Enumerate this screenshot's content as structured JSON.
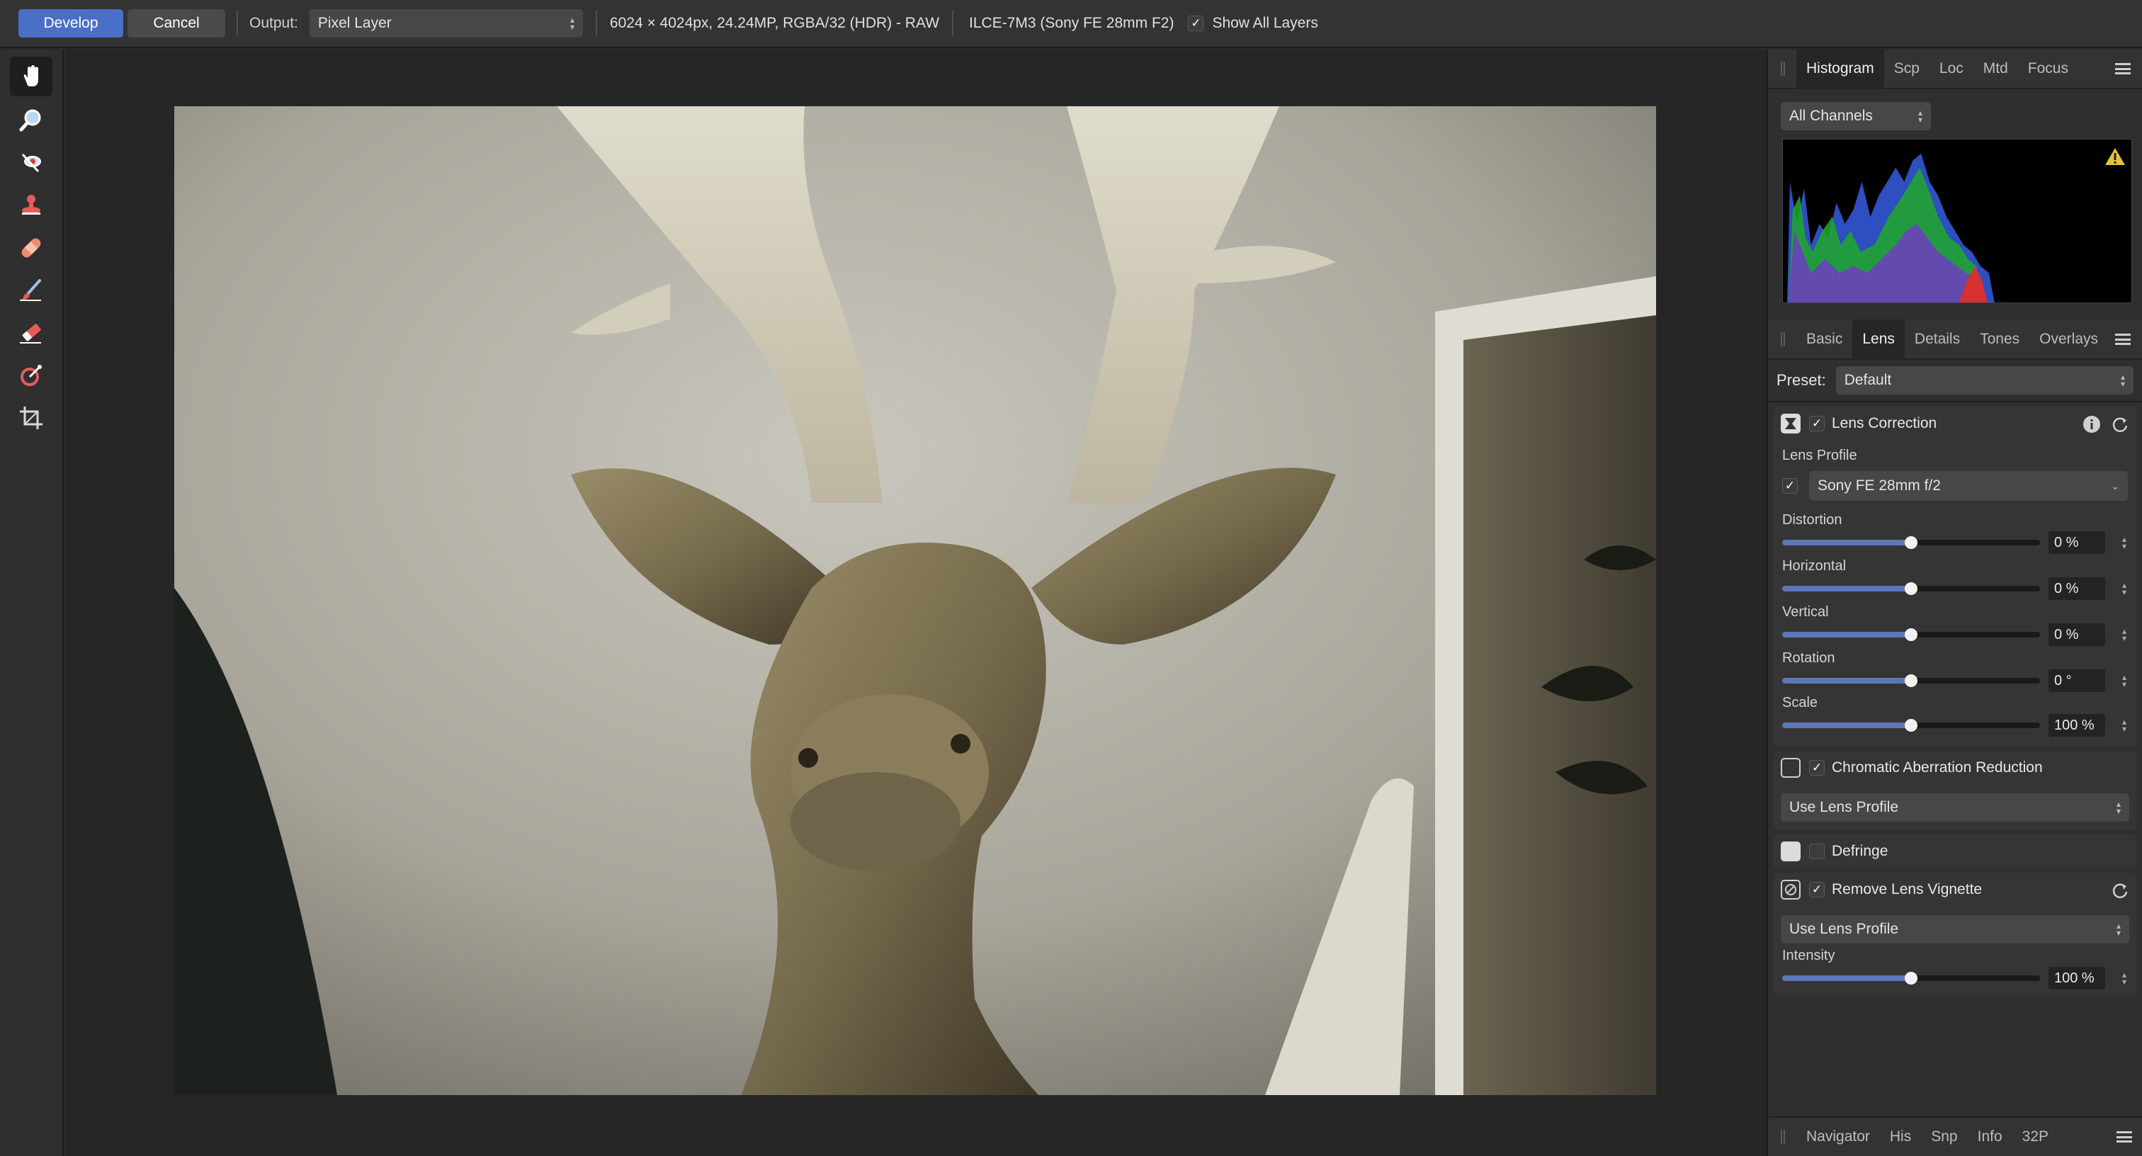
{
  "toolbar": {
    "develop_label": "Develop",
    "cancel_label": "Cancel",
    "output_label": "Output:",
    "output_value": "Pixel Layer",
    "image_info": "6024 × 4024px, 24.24MP, RGBA/32 (HDR) - RAW",
    "camera_info": "ILCE-7M3 (Sony FE 28mm F2)",
    "show_all_layers_label": "Show All Layers",
    "show_all_layers_checked": true
  },
  "tools": [
    {
      "name": "hand-tool",
      "icon": "hand-icon",
      "active": true
    },
    {
      "name": "zoom-tool",
      "icon": "magnifier-icon"
    },
    {
      "name": "red-eye-tool",
      "icon": "red-eye-icon"
    },
    {
      "name": "clone-tool",
      "icon": "stamp-icon"
    },
    {
      "name": "blemish-tool",
      "icon": "bandage-icon"
    },
    {
      "name": "overlay-paint-tool",
      "icon": "brush-icon"
    },
    {
      "name": "overlay-erase-tool",
      "icon": "eraser-icon"
    },
    {
      "name": "gradient-tool",
      "icon": "gradient-icon"
    },
    {
      "name": "crop-tool",
      "icon": "crop-icon"
    }
  ],
  "top_panel": {
    "tabs": [
      "Histogram",
      "Scp",
      "Loc",
      "Mtd",
      "Focus"
    ],
    "active_tab": "Histogram",
    "channel_select": "All Channels"
  },
  "adjust_panel": {
    "tabs": [
      "Basic",
      "Lens",
      "Details",
      "Tones",
      "Overlays"
    ],
    "active_tab": "Lens",
    "preset_label": "Preset:",
    "preset_value": "Default",
    "lens_correction": {
      "title": "Lens Correction",
      "enabled": true,
      "lens_profile_label": "Lens Profile",
      "lens_profile_value": "Sony FE 28mm f/2",
      "sliders": [
        {
          "label": "Distortion",
          "value": "0 %",
          "position": 0.5
        },
        {
          "label": "Horizontal",
          "value": "0 %",
          "position": 0.5
        },
        {
          "label": "Vertical",
          "value": "0 %",
          "position": 0.5
        },
        {
          "label": "Rotation",
          "value": "0 °",
          "position": 0.5
        },
        {
          "label": "Scale",
          "value": "100 %",
          "position": 0.5
        }
      ]
    },
    "chromatic": {
      "title": "Chromatic Aberration Reduction",
      "enabled": true,
      "mode": "Use Lens Profile"
    },
    "defringe": {
      "title": "Defringe",
      "enabled": false
    },
    "vignette": {
      "title": "Remove Lens Vignette",
      "enabled": true,
      "mode": "Use Lens Profile",
      "intensity_label": "Intensity",
      "intensity_value": "100 %",
      "intensity_position": 0.5
    }
  },
  "bottom_panel": {
    "tabs": [
      "Navigator",
      "His",
      "Snp",
      "Info",
      "32P"
    ]
  },
  "colors": {
    "accent": "#4a6fc7",
    "slider_fill": "#5b78b6"
  }
}
